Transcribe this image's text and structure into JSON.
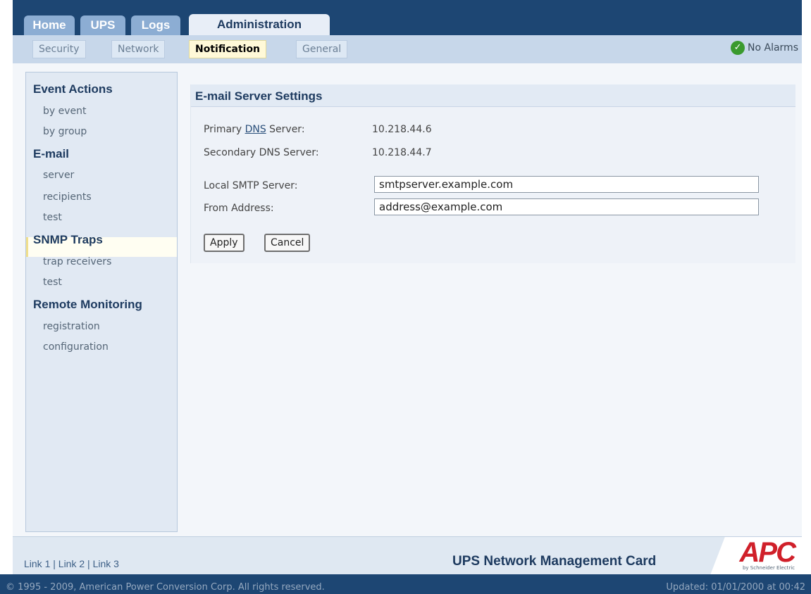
{
  "tabs": [
    "Home",
    "UPS",
    "Logs",
    "Administration"
  ],
  "subtabs": [
    "Security",
    "Network",
    "Notification",
    "General"
  ],
  "alarm": "No Alarms",
  "nav": {
    "event_actions": "Event Actions",
    "by_event": "by event",
    "by_group": "by group",
    "email": "E-mail",
    "server": "server",
    "recipients": "recipients",
    "test": "test",
    "snmp_traps": "SNMP Traps",
    "trap_receivers": "trap receivers",
    "test2": "test",
    "remote_monitoring": "Remote Monitoring",
    "registration": "registration",
    "configuration": "configuration"
  },
  "content": {
    "title": "E-mail Server Settings",
    "primary_dns_label_pre": "Primary ",
    "primary_dns_label_abbr": "DNS",
    "primary_dns_label_post": " Server:",
    "primary_dns_value": "10.218.44.6",
    "secondary_dns_label": "Secondary DNS Server:",
    "secondary_dns_value": "10.218.44.7",
    "smtp_label": "Local SMTP Server:",
    "smtp_value": "smtpserver.example.com",
    "from_label": "From Address:",
    "from_value": "address@example.com",
    "apply": "Apply",
    "cancel": "Cancel"
  },
  "footer": {
    "link1": "Link 1",
    "link2": "Link 2",
    "link3": "Link 3",
    "separator": " | ",
    "product": "UPS Network Management Card",
    "logo": "APC",
    "logo_sub": "by Schneider Electric",
    "copyright": "© 1995 - 2009, American Power Conversion Corp. All rights reserved.",
    "updated": "Updated: 01/01/2000 at 00:42"
  }
}
